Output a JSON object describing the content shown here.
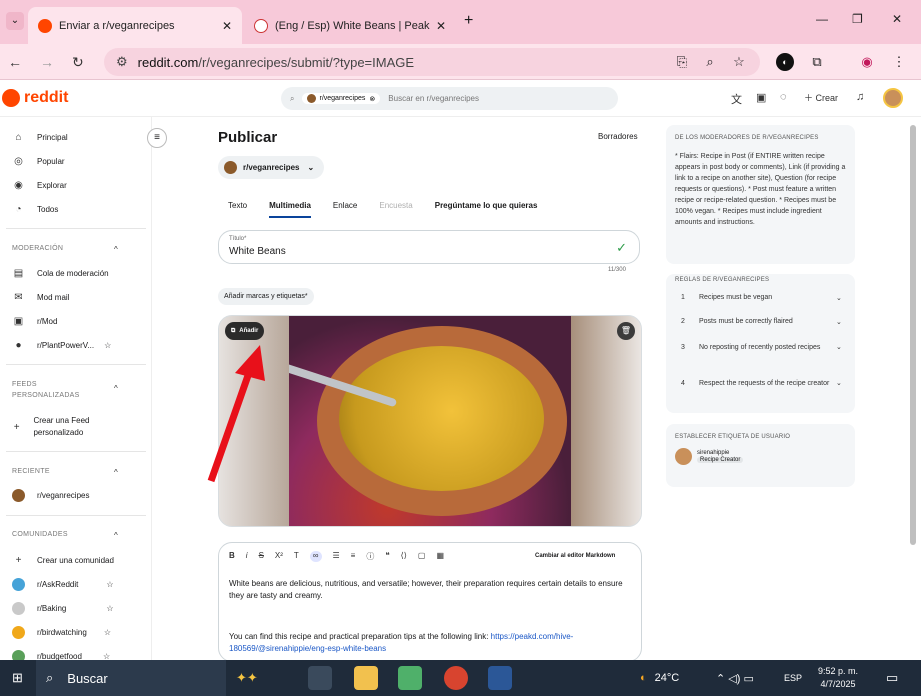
{
  "browser": {
    "tabs": [
      {
        "label": "Enviar a r/veganrecipes",
        "close": "✕"
      },
      {
        "label": "(Eng / Esp) White Beans | PeakD",
        "close": "✕"
      }
    ],
    "new_tab": "+",
    "url_domain": "reddit.com",
    "url_path": "/r/veganrecipes/submit/?type=IMAGE",
    "win_min": "—",
    "win_max": "❐",
    "win_close": "✕"
  },
  "header": {
    "logo": "reddit",
    "search_chip": "r/veganrecipes",
    "search_placeholder": "Buscar en r/veganrecipes",
    "create": "Crear"
  },
  "sidebar": {
    "main": [
      {
        "label": "Principal",
        "icon": "⌂"
      },
      {
        "label": "Popular",
        "icon": "◎"
      },
      {
        "label": "Explorar",
        "icon": "◉"
      },
      {
        "label": "Todos",
        "icon": "◔"
      }
    ],
    "moderation_header": "MODERACIÓN",
    "moderation": [
      {
        "label": "Cola de moderación",
        "icon": "▤"
      },
      {
        "label": "Mod mail",
        "icon": "✉"
      },
      {
        "label": "r/Mod",
        "icon": "▣"
      },
      {
        "label": "r/PlantPowerV...",
        "icon": "●"
      }
    ],
    "feeds_header": "FEEDS PERSONALIZADAS",
    "create_feed": "Crear una Feed personalizado",
    "recent_header": "RECIENTE",
    "recent": "r/veganrecipes",
    "communities_header": "COMUNIDADES",
    "create_community": "Crear una comunidad",
    "communities": [
      "r/AskReddit",
      "r/Baking",
      "r/birdwatching",
      "r/budgetfood"
    ]
  },
  "post": {
    "title": "Publicar",
    "drafts": "Borradores",
    "subreddit": "r/veganrecipes",
    "tabs": [
      "Texto",
      "Multimedia",
      "Enlace",
      "Encuesta",
      "Pregúntame lo que quieras"
    ],
    "title_label": "Título*",
    "title_value": "White Beans",
    "counter": "11/300",
    "flair_button": "Añadir marcas y etiquetas*",
    "add_label": "Añadir",
    "markdown_switch": "Cambiar al editor Markdown",
    "body_p1": "White beans are delicious, nutritious, and versatile; however, their preparation requires certain details to ensure they are tasty and creamy.",
    "body_p2a": "You can find this recipe and practical preparation tips at the following link: ",
    "body_link": "https://peakd.com/hive-180569/@sirenahippie/eng-esp-white-beans"
  },
  "right": {
    "mods_title": "DE LOS MODERADORES DE R/VEGANRECIPES",
    "mods_text": "* Flairs: Recipe in Post (if ENTIRE written recipe appears in post body or comments), Link (if providing a link to a recipe on another site), Question (for recipe requests or questions). * Post must feature a written recipe or recipe-related question. * Recipes must be 100% vegan. * Recipes must include ingredient amounts and instructions.",
    "rules_title": "REGLAS DE R/VEGANRECIPES",
    "rules": [
      {
        "n": "1",
        "t": "Recipes must be vegan"
      },
      {
        "n": "2",
        "t": "Posts must be correctly flaired"
      },
      {
        "n": "3",
        "t": "No reposting of recently posted recipes"
      },
      {
        "n": "4",
        "t": "Respect the requests of the recipe creator"
      }
    ],
    "userflair_title": "ESTABLECER ETIQUETA DE USUARIO",
    "username": "sirenahippie",
    "badge": "Recipe Creator"
  },
  "taskbar": {
    "search": "Buscar",
    "temp": "24°C",
    "lang": "ESP",
    "time": "9:52 p. m.",
    "date": "4/7/2025"
  }
}
